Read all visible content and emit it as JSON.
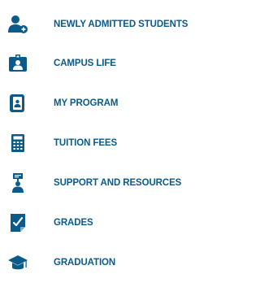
{
  "colors": {
    "accent": "#0a5a8a",
    "background": "#ffffff"
  },
  "menu": {
    "items": [
      {
        "label": "NEWLY ADMITTED STUDENTS",
        "icon": "add-user-icon"
      },
      {
        "label": "CAMPUS LIFE",
        "icon": "id-badge-icon"
      },
      {
        "label": "MY PROGRAM",
        "icon": "contact-book-icon"
      },
      {
        "label": "TUITION FEES",
        "icon": "calculator-icon"
      },
      {
        "label": "SUPPORT AND RESOURCES",
        "icon": "presenter-icon"
      },
      {
        "label": "GRADES",
        "icon": "graded-paper-icon"
      },
      {
        "label": "GRADUATION",
        "icon": "graduation-cap-icon"
      }
    ]
  }
}
